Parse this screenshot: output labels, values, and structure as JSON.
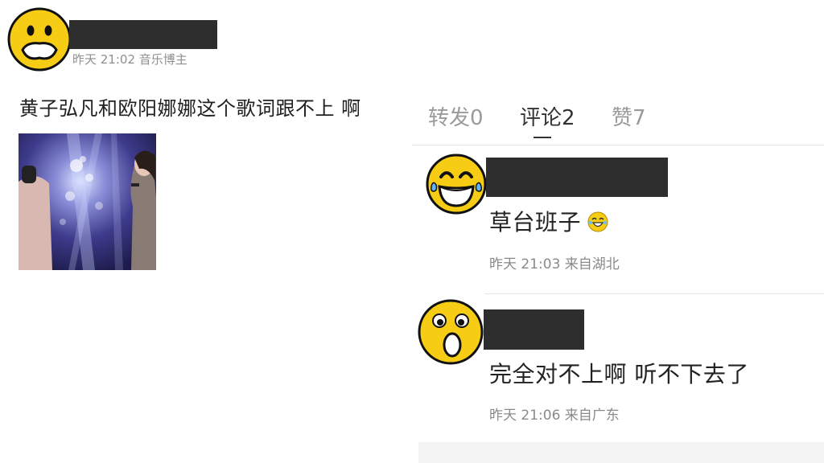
{
  "post": {
    "meta": "昨天 21:02 音乐博主",
    "text": "黄子弘凡和欧阳娜娜这个歌词跟不上 啊"
  },
  "tabs": {
    "repost": "转发0",
    "comment": "评论2",
    "like": "赞7"
  },
  "comments": [
    {
      "text": "草台班子",
      "meta": "昨天 21:03 来自湖北"
    },
    {
      "text": "完全对不上啊 听不下去了",
      "meta": "昨天 21:06 来自广东"
    }
  ],
  "colors": {
    "emoji_yellow": "#f6cc14",
    "redaction": "#2e2e2e",
    "tab_active": "#333333",
    "tab_inactive": "#9a9a9a"
  }
}
